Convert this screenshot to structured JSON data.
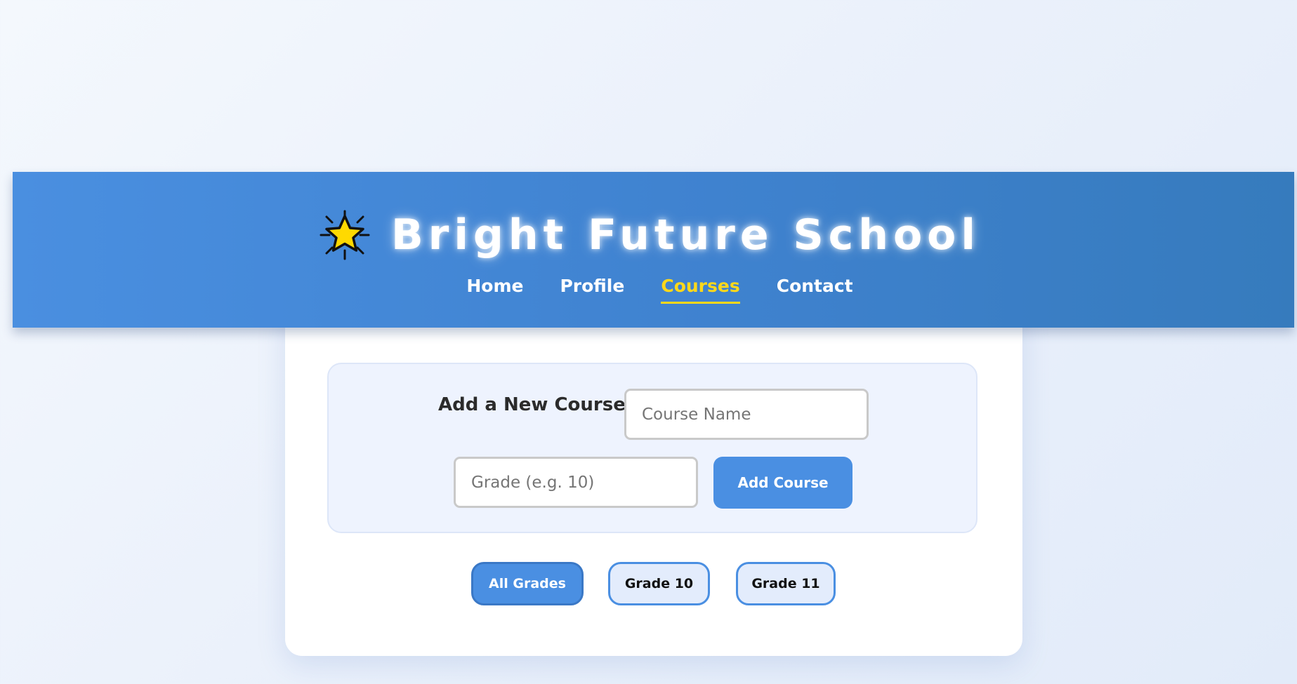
{
  "header": {
    "title": "Bright Future School",
    "logo_icon": "star-icon",
    "nav": [
      {
        "label": "Home",
        "active": false
      },
      {
        "label": "Profile",
        "active": false
      },
      {
        "label": "Courses",
        "active": true
      },
      {
        "label": "Contact",
        "active": false
      }
    ]
  },
  "add_course": {
    "heading": "Add a New Course",
    "course_name_placeholder": "Course Name",
    "grade_placeholder": "Grade (e.g. 10)",
    "button_label": "Add Course"
  },
  "filters": [
    {
      "label": "All Grades",
      "active": true
    },
    {
      "label": "Grade 10",
      "active": false
    },
    {
      "label": "Grade 11",
      "active": false
    }
  ],
  "colors": {
    "primary": "#4a8fe2",
    "active_nav": "#ffd81a",
    "panel_bg": "#eef3fe"
  }
}
